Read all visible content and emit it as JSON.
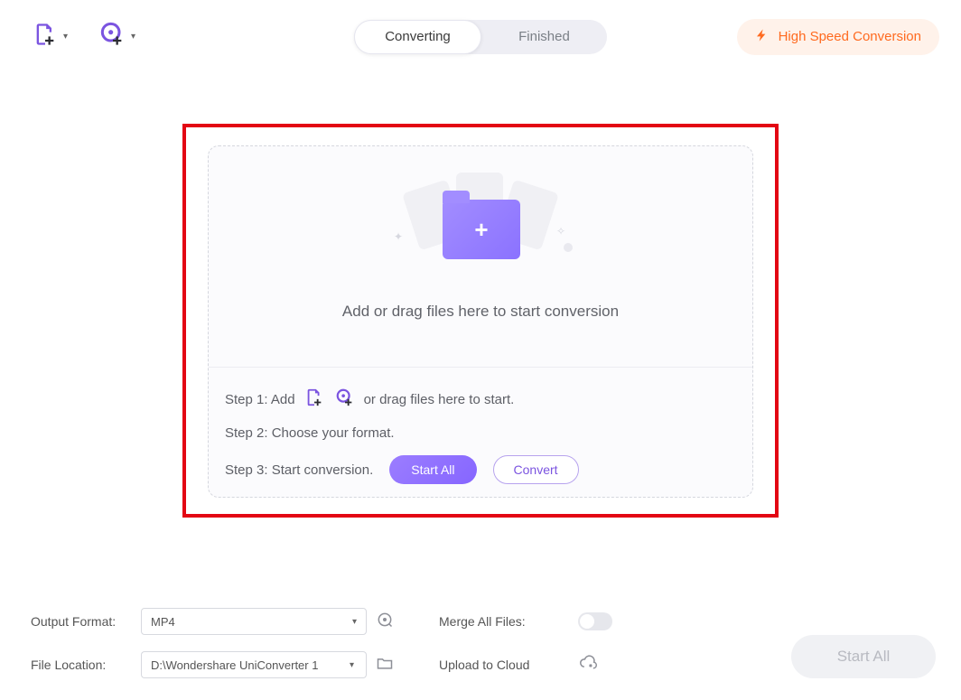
{
  "toolbar": {
    "icons": {
      "file": "add-file-icon",
      "disc": "add-disc-icon"
    },
    "tabs": {
      "converting": "Converting",
      "finished": "Finished"
    },
    "hsc_label": "High Speed Conversion"
  },
  "dropzone": {
    "headline": "Add or drag files here to start conversion"
  },
  "steps": {
    "s1a": "Step 1: Add",
    "s1b": "or drag files here to start.",
    "s2": "Step 2: Choose your format.",
    "s3": "Step 3: Start conversion.",
    "start_all": "Start All",
    "convert": "Convert"
  },
  "bottom": {
    "output_format_label": "Output Format:",
    "output_format_value": "MP4",
    "file_location_label": "File Location:",
    "file_location_value": "D:\\Wondershare UniConverter 1",
    "merge_label": "Merge All Files:",
    "upload_label": "Upload to Cloud",
    "big_start": "Start All"
  },
  "colors": {
    "accent": "#8666ff",
    "warn": "#ff6a1f",
    "highlight": "#e30613"
  }
}
